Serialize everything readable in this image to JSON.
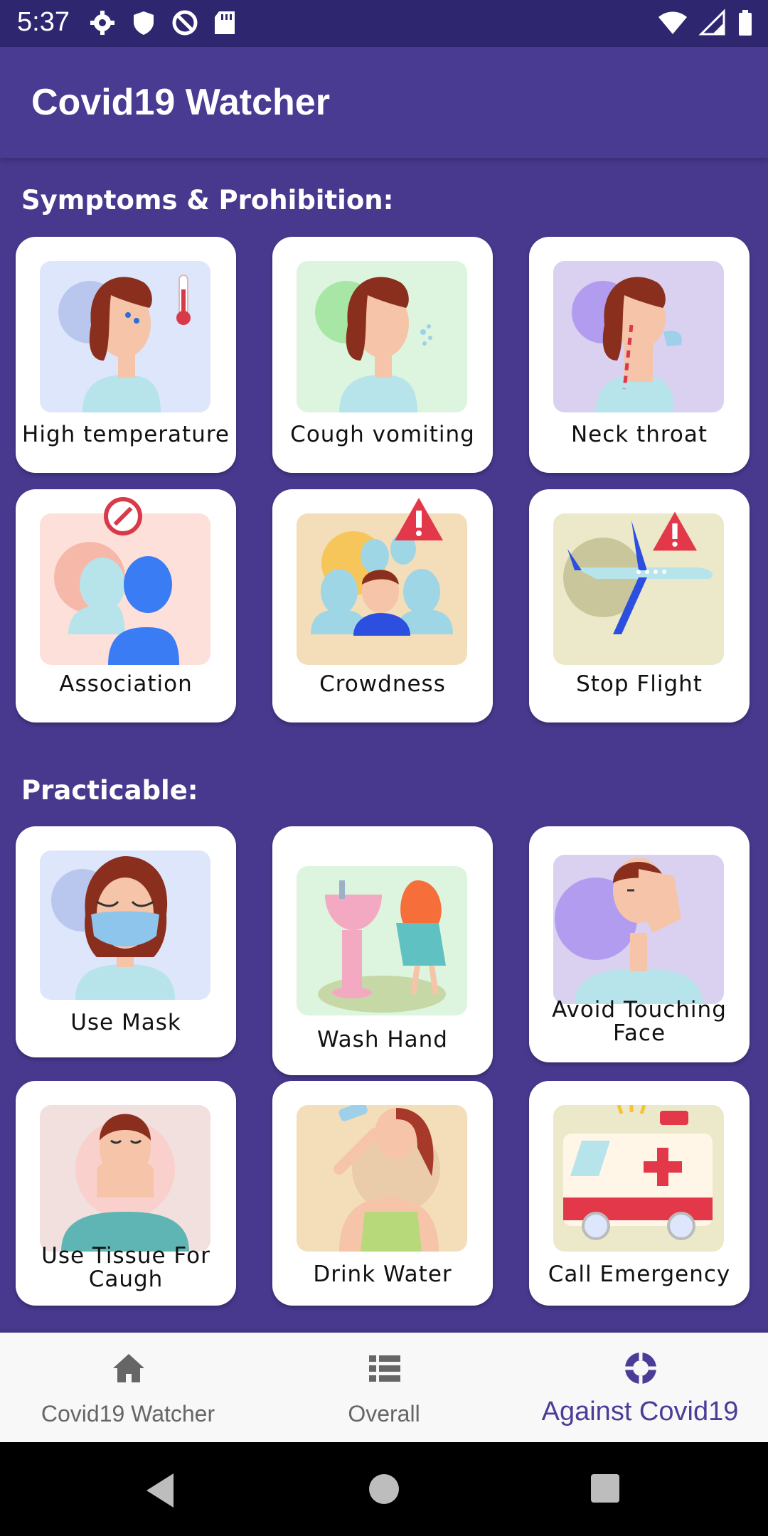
{
  "status_bar": {
    "time": "5:37",
    "left_icons": [
      "settings-icon",
      "shield-icon",
      "no-sim-icon",
      "sd-card-icon"
    ],
    "right_icons": [
      "wifi-icon",
      "signal-icon",
      "battery-icon"
    ]
  },
  "app_bar": {
    "title": "Covid19 Watcher"
  },
  "sections": {
    "symptoms": {
      "title": "Symptoms & Prohibition:"
    },
    "practicable": {
      "title": "Practicable:"
    }
  },
  "cards": {
    "high_temperature": {
      "label": "High temperature",
      "icon": "fever-thermometer-icon",
      "bg": "#dde6fb"
    },
    "cough_vomiting": {
      "label": "Cough vomiting",
      "icon": "coughing-person-icon",
      "bg": "#ddf5df"
    },
    "neck_throat": {
      "label": "Neck throat",
      "icon": "sore-throat-icon",
      "bg": "#d9d1ef"
    },
    "association": {
      "label": "Association",
      "icon": "no-contact-icon",
      "bg": "#fde0da"
    },
    "crowdness": {
      "label": "Crowdness",
      "icon": "crowd-warning-icon",
      "bg": "#f4deba"
    },
    "stop_flight": {
      "label": "Stop Flight",
      "icon": "airplane-warning-icon",
      "bg": "#ebe9c9"
    },
    "use_mask": {
      "label": "Use Mask",
      "icon": "face-mask-icon",
      "bg": "#dde6fb"
    },
    "wash_hand": {
      "label": "Wash Hand",
      "icon": "hand-washing-icon",
      "bg": "#ddf5df"
    },
    "avoid_touching_face": {
      "label": "Avoid Touching Face",
      "icon": "touching-face-icon",
      "bg": "#d9d1ef"
    },
    "use_tissue": {
      "label": "Use Tissue For Caugh",
      "icon": "tissue-sneeze-icon",
      "bg": "#f1e0de"
    },
    "drink_water": {
      "label": "Drink Water",
      "icon": "drinking-water-icon",
      "bg": "#f4deba"
    },
    "call_emergency": {
      "label": "Call Emergency",
      "icon": "ambulance-icon",
      "bg": "#ebe9c9"
    }
  },
  "bottom_nav": {
    "items": [
      {
        "label": "Covid19 Watcher",
        "icon": "home-icon",
        "active": false
      },
      {
        "label": "Overall",
        "icon": "list-icon",
        "active": false
      },
      {
        "label": "Against Covid19",
        "icon": "lifebuoy-icon",
        "active": true
      }
    ]
  },
  "colors": {
    "primary": "#48398e",
    "accent": "#4a3d97",
    "card_bg": "#ffffff"
  }
}
